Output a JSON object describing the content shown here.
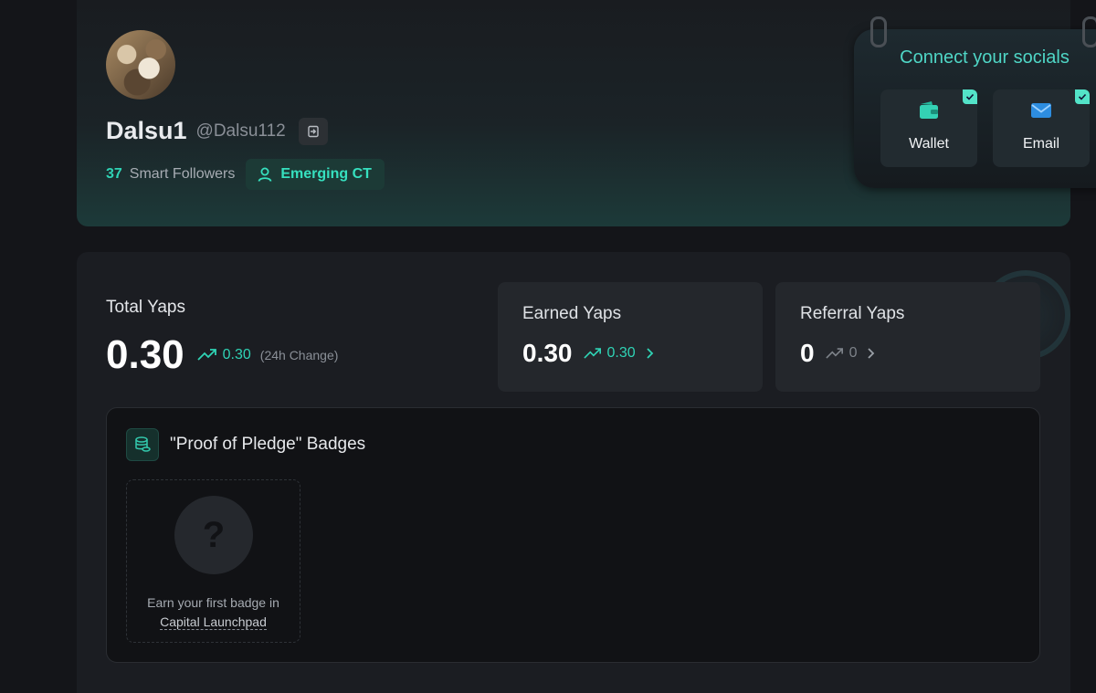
{
  "profile": {
    "name": "Dalsu1",
    "handle": "@Dalsu112",
    "smart_followers_count": "37",
    "smart_followers_label": "Smart Followers",
    "tier_label": "Emerging CT"
  },
  "socials": {
    "title": "Connect your socials",
    "items": [
      {
        "label": "Wallet",
        "icon": "wallet-icon",
        "connected": true
      },
      {
        "label": "Email",
        "icon": "mail-icon",
        "connected": true
      }
    ]
  },
  "yaps": {
    "total_label": "Total Yaps",
    "total_value": "0.30",
    "total_change": "0.30",
    "total_change_note": "(24h Change)",
    "earned_label": "Earned Yaps",
    "earned_value": "0.30",
    "earned_change": "0.30",
    "referral_label": "Referral Yaps",
    "referral_value": "0",
    "referral_change": "0"
  },
  "badges": {
    "title": "\"Proof of Pledge\" Badges",
    "empty_text_prefix": "Earn your first badge in",
    "empty_link": "Capital Launchpad",
    "placeholder_glyph": "?"
  },
  "colors": {
    "accent": "#2fd3b5",
    "background": "#141519",
    "card": "#1b1d22"
  }
}
